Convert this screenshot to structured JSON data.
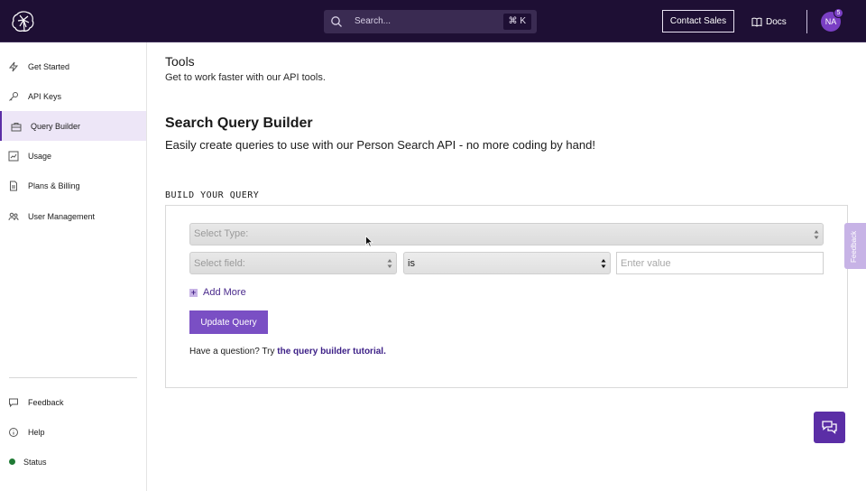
{
  "header": {
    "search_placeholder": "Search...",
    "search_shortcut": "⌘ K",
    "contact_label": "Contact Sales",
    "docs_label": "Docs",
    "avatar_initials": "NA",
    "notification_count": "5"
  },
  "sidebar": {
    "items": [
      {
        "label": "Get Started",
        "icon": "bolt-icon"
      },
      {
        "label": "API Keys",
        "icon": "key-icon"
      },
      {
        "label": "Query Builder",
        "icon": "toolbox-icon",
        "active": true
      },
      {
        "label": "Usage",
        "icon": "chart-icon"
      },
      {
        "label": "Plans & Billing",
        "icon": "document-icon"
      },
      {
        "label": "User Management",
        "icon": "users-icon"
      }
    ],
    "bottom": [
      {
        "label": "Feedback",
        "icon": "comment-icon"
      },
      {
        "label": "Help",
        "icon": "info-icon"
      },
      {
        "label": "Status",
        "icon": "status-dot"
      }
    ]
  },
  "main": {
    "title": "Tools",
    "subtitle": "Get to work faster with our API tools.",
    "section_title": "Search Query Builder",
    "section_subtitle": "Easily create queries to use with our Person Search API - no more coding by hand!",
    "build_label": "BUILD YOUR QUERY",
    "type_select": "Select Type:",
    "field_select": "Select field:",
    "operator_select": "is",
    "value_placeholder": "Enter value",
    "add_more": "Add More",
    "update_button": "Update Query",
    "question_text": "Have a question? Try ",
    "tutorial_link": "the query builder tutorial."
  },
  "feedback_tab": "Feedback",
  "colors": {
    "header_bg": "#1e0f34",
    "accent": "#7a4fc4",
    "active_bg": "#ede6f7",
    "link": "#3b1e86",
    "status_ok": "#1f7a34"
  }
}
